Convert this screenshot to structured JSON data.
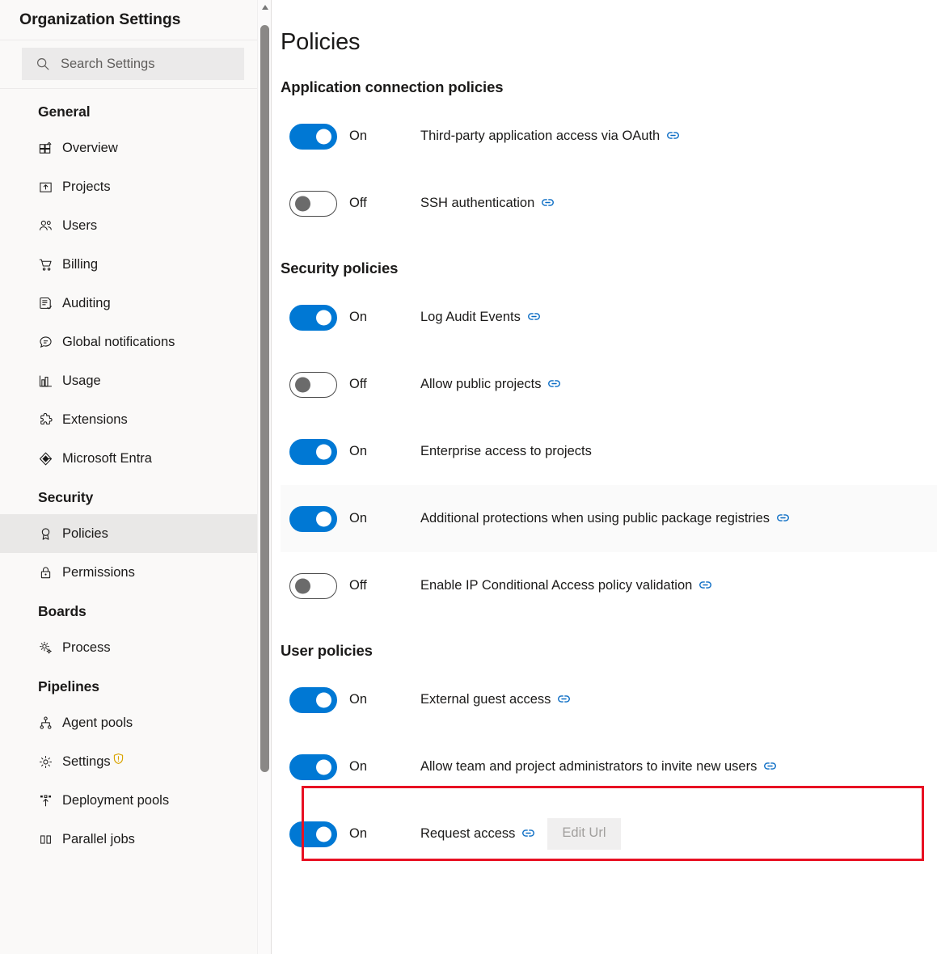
{
  "sidebar": {
    "title": "Organization Settings",
    "search": {
      "placeholder": "Search Settings",
      "value": "",
      "icon": "search-icon"
    },
    "groups": [
      {
        "title": "General",
        "items": [
          {
            "label": "Overview",
            "icon": "overview-icon",
            "selected": false
          },
          {
            "label": "Projects",
            "icon": "projects-icon",
            "selected": false
          },
          {
            "label": "Users",
            "icon": "users-icon",
            "selected": false
          },
          {
            "label": "Billing",
            "icon": "billing-cart-icon",
            "selected": false
          },
          {
            "label": "Auditing",
            "icon": "auditing-icon",
            "selected": false
          },
          {
            "label": "Global notifications",
            "icon": "notifications-icon",
            "selected": false
          },
          {
            "label": "Usage",
            "icon": "usage-chart-icon",
            "selected": false
          },
          {
            "label": "Extensions",
            "icon": "extensions-puzzle-icon",
            "selected": false
          },
          {
            "label": "Microsoft Entra",
            "icon": "microsoft-entra-icon",
            "selected": false
          }
        ]
      },
      {
        "title": "Security",
        "items": [
          {
            "label": "Policies",
            "icon": "policies-ribbon-icon",
            "selected": true
          },
          {
            "label": "Permissions",
            "icon": "permissions-lock-icon",
            "selected": false
          }
        ]
      },
      {
        "title": "Boards",
        "items": [
          {
            "label": "Process",
            "icon": "process-gears-icon",
            "selected": false
          }
        ]
      },
      {
        "title": "Pipelines",
        "items": [
          {
            "label": "Agent pools",
            "icon": "agent-pools-icon",
            "selected": false
          },
          {
            "label": "Settings",
            "icon": "settings-gear-icon",
            "selected": false,
            "badge": "shield-warning-icon"
          },
          {
            "label": "Deployment pools",
            "icon": "deployment-pools-icon",
            "selected": false
          },
          {
            "label": "Parallel jobs",
            "icon": "parallel-jobs-icon",
            "selected": false
          }
        ]
      }
    ]
  },
  "main": {
    "page_title": "Policies",
    "sections": [
      {
        "title": "Application connection policies",
        "policies": [
          {
            "state": "On",
            "on": true,
            "label": "Third-party application access via OAuth",
            "has_link": true,
            "shaded": false
          },
          {
            "state": "Off",
            "on": false,
            "label": "SSH authentication",
            "has_link": true,
            "shaded": false
          }
        ]
      },
      {
        "title": "Security policies",
        "policies": [
          {
            "state": "On",
            "on": true,
            "label": "Log Audit Events",
            "has_link": true,
            "shaded": false
          },
          {
            "state": "Off",
            "on": false,
            "label": "Allow public projects",
            "has_link": true,
            "shaded": false
          },
          {
            "state": "On",
            "on": true,
            "label": "Enterprise access to projects",
            "has_link": false,
            "shaded": false
          },
          {
            "state": "On",
            "on": true,
            "label": "Additional protections when using public package registries",
            "has_link": true,
            "shaded": true
          },
          {
            "state": "Off",
            "on": false,
            "label": "Enable IP Conditional Access policy validation",
            "has_link": true,
            "shaded": false
          }
        ]
      },
      {
        "title": "User policies",
        "policies": [
          {
            "state": "On",
            "on": true,
            "label": "External guest access",
            "has_link": true,
            "shaded": false
          },
          {
            "state": "On",
            "on": true,
            "label": "Allow team and project administrators to invite new users",
            "has_link": true,
            "shaded": false,
            "highlighted": true
          },
          {
            "state": "On",
            "on": true,
            "label": "Request access",
            "has_link": true,
            "shaded": false,
            "button": "Edit Url"
          }
        ]
      }
    ]
  },
  "colors": {
    "accent": "#0078d4",
    "link": "#0a6cc4",
    "highlight_box": "#e81123",
    "sidebar_bg": "#faf9f8",
    "selected_item_bg": "#e9e8e7",
    "badge_warning": "#d9a400"
  },
  "scrollbar": {
    "up_arrow": "scroll-up-arrow-icon"
  }
}
